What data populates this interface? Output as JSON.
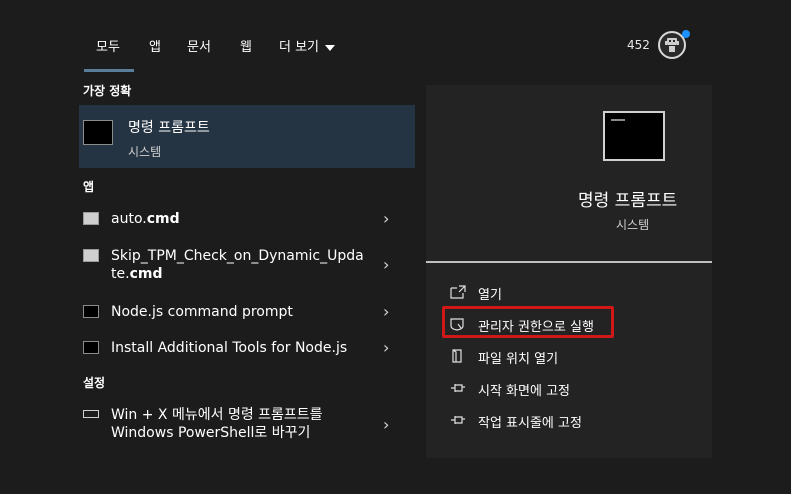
{
  "tabs": [
    {
      "label": "모두"
    },
    {
      "label": "앱"
    },
    {
      "label": "문서"
    },
    {
      "label": "웹"
    },
    {
      "label": "더 보기"
    }
  ],
  "points": "452",
  "sections": {
    "best_match": "가장 정확",
    "apps": "앱",
    "settings": "설정"
  },
  "best_match": {
    "title": "명령 프롬프트",
    "subtitle": "시스템",
    "icon": "cmd-icon"
  },
  "apps": [
    {
      "name_plain": "auto.",
      "name_bold": "cmd",
      "icon": "file-icon"
    },
    {
      "name_line1": "Skip_TPM_Check_on_Dynamic_Upda",
      "name_line2_plain": "te.",
      "name_line2_bold": "cmd",
      "icon": "file-icon"
    },
    {
      "name": "Node.js command prompt",
      "icon": "cmd-icon"
    },
    {
      "name": "Install Additional Tools for Node.js",
      "icon": "cmd-icon"
    }
  ],
  "settings_items": [
    {
      "line1": "Win + X 메뉴에서 명령 프롬프트를",
      "line2": "Windows PowerShell로 바꾸기",
      "icon": "monitor-icon"
    }
  ],
  "detail": {
    "title": "명령 프롬프트",
    "subtitle": "시스템",
    "actions": [
      {
        "label": "열기",
        "icon": "open-icon"
      },
      {
        "label": "관리자 권한으로 실행",
        "icon": "shield-icon"
      },
      {
        "label": "파일 위치 열기",
        "icon": "folder-icon"
      },
      {
        "label": "시작 화면에 고정",
        "icon": "pin-icon"
      },
      {
        "label": "작업 표시줄에 고정",
        "icon": "pin-icon"
      }
    ]
  },
  "colors": {
    "background": "#1c1c1c",
    "selected": "#253443",
    "highlight_border": "#d01818",
    "notification": "#1e90ff"
  }
}
